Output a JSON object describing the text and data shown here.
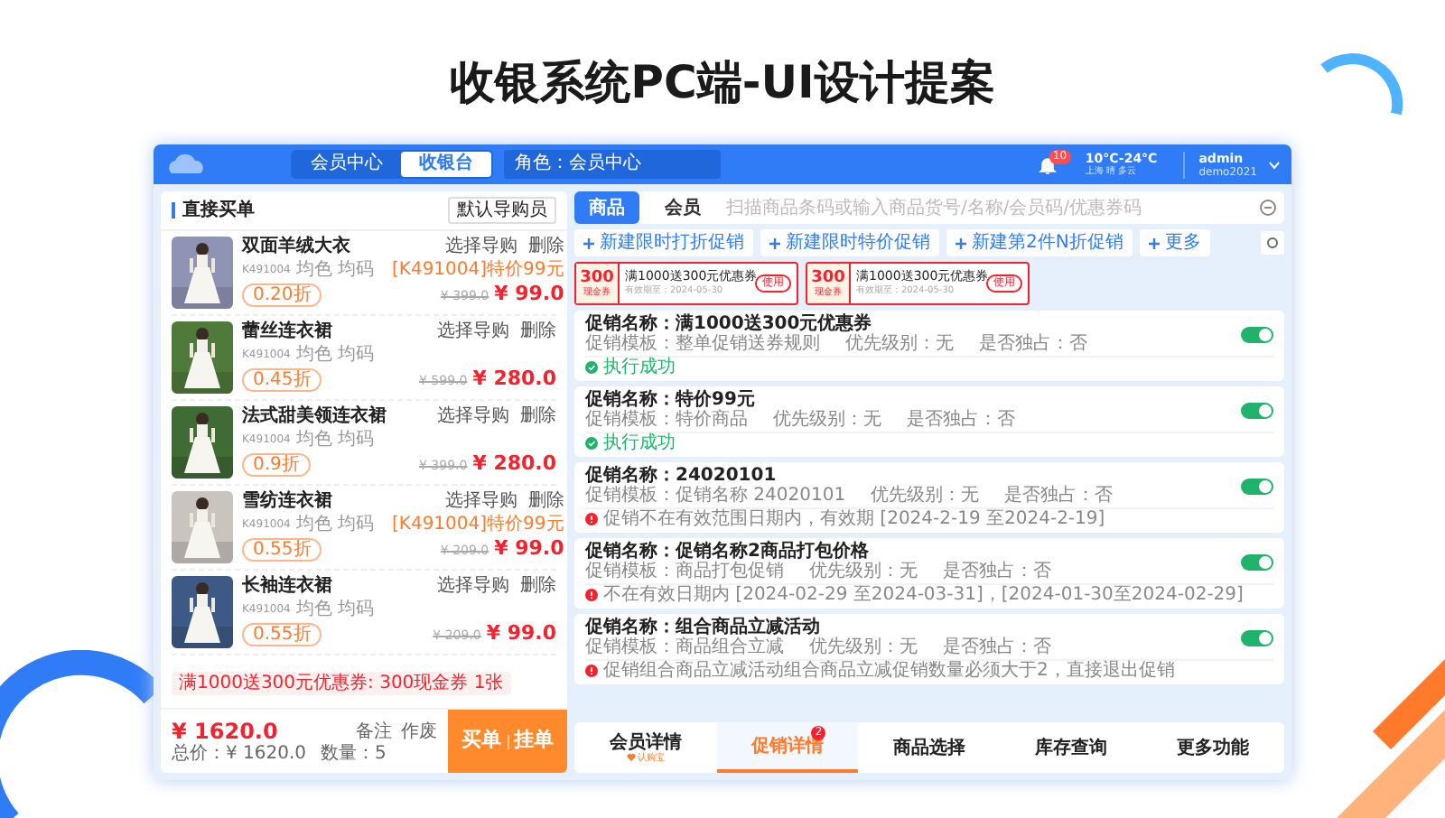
{
  "slide_title": "收银系统PC端-UI设计提案",
  "app": {
    "header": {
      "nav_tabs": [
        {
          "label": "会员中心",
          "selected": false
        },
        {
          "label": "收银台",
          "selected": true
        }
      ],
      "role_select": "角色：会员中心",
      "notification_count": "10",
      "weather": "10°C-24°C",
      "weather_place": "上海 晴 多云",
      "user": "admin",
      "user_id": "demo2021"
    },
    "cart": {
      "title": "直接买单",
      "guide_button": "默认导购员",
      "items": [
        {
          "name": "双面羊绒大衣",
          "code": "K491004",
          "color_name": "均色",
          "size": "均码",
          "discount": "0.20折",
          "guide": "选择导购",
          "delete": "删除",
          "note": "[K491004]特价99元",
          "original_price": "¥ 399.0",
          "price": "¥ 99.0"
        },
        {
          "name": "蕾丝连衣裙",
          "code": "K491004",
          "color_name": "均色",
          "size": "均码",
          "discount": "0.45折",
          "guide": "选择导购",
          "delete": "删除",
          "original_price": "¥ 599.0",
          "price": "¥ 280.0"
        },
        {
          "name": "法式甜美领连衣裙",
          "code": "K491004",
          "color_name": "均色",
          "size": "均码",
          "discount": "0.9折",
          "guide": "选择导购",
          "delete": "删除",
          "original_price": "¥ 399.0",
          "price": "¥ 280.0"
        },
        {
          "name": "雪纺连衣裙",
          "code": "K491004",
          "color_name": "均色",
          "size": "均码",
          "discount": "0.55折",
          "guide": "选择导购",
          "delete": "删除",
          "note": "[K491004]特价99元",
          "original_price": "¥ 209.0",
          "price": "¥ 99.0"
        },
        {
          "name": "长袖连衣裙",
          "code": "K491004",
          "color_name": "均色",
          "size": "均码",
          "discount": "0.55折",
          "guide": "选择导购",
          "delete": "删除",
          "original_price": "¥ 209.0",
          "price": "¥ 99.0"
        }
      ],
      "coupon_note": "满1000送300元优惠券: 300现金券 1张",
      "total": "¥ 1620.0",
      "total_label": "总价：¥ 1620.0",
      "count_label": "数量：5",
      "remark_button": "备注",
      "void_button": "作废",
      "checkout_button": "买单",
      "hold_button": "挂单"
    },
    "panel": {
      "tabs": [
        {
          "label": "商品",
          "selected": true
        },
        {
          "label": "会员",
          "selected": false
        }
      ],
      "search": {
        "placeholder": "扫描商品条码或输入商品货号/名称/会员码/优惠券码"
      },
      "actions": [
        "新建限时打折促销",
        "新建限时特价促销",
        "新建第2件N折促销",
        "更多"
      ],
      "coupons": [
        {
          "amount": "300",
          "unit": "现金券",
          "title": "满1000送300元优惠券",
          "expiry": "有效期至：2024-05-30",
          "action": "使用"
        },
        {
          "amount": "300",
          "unit": "现金券",
          "title": "满1000送300元优惠券",
          "expiry": "有效期至：2024-05-30",
          "action": "使用"
        }
      ],
      "promotions": [
        {
          "name": "促销名称：满1000送300元优惠券",
          "template": "促销模板：整单促销送券规则",
          "priority": "优先级别：无",
          "exclusive": "是否独占：否",
          "on": true,
          "kind": "success",
          "message": "执行成功"
        },
        {
          "name": "促销名称：特价99元",
          "template": "促销模板：特价商品",
          "priority": "优先级别：无",
          "exclusive": "是否独占：否",
          "on": true,
          "kind": "success",
          "message": "执行成功"
        },
        {
          "name": "促销名称：24020101",
          "template": "促销模板：促销名称 24020101",
          "priority": "优先级别：无",
          "exclusive": "是否独占：否",
          "on": true,
          "kind": "error",
          "message": "促销不在有效范围日期内，有效期 [2024-2-19 至2024-2-19]"
        },
        {
          "name": "促销名称：促销名称2商品打包价格",
          "template": "促销模板：商品打包促销",
          "priority": "优先级别：无",
          "exclusive": "是否独占：否",
          "on": true,
          "kind": "error",
          "message": "不在有效日期内 [2024-02-29 至2024-03-31]，[2024-01-30至2024-02-29]"
        },
        {
          "name": "促销名称：组合商品立减活动",
          "template": "促销模板：商品组合立减",
          "priority": "优先级别：无",
          "exclusive": "是否独占：否",
          "on": true,
          "kind": "error",
          "message": "促销组合商品立减活动组合商品立减促销数量必须大于2，直接退出促销"
        }
      ],
      "bottom_tabs": [
        {
          "label": "会员详情",
          "sub": "认购宝",
          "selected": false
        },
        {
          "label": "促销详情",
          "badge": "2",
          "selected": true
        },
        {
          "label": "商品选择",
          "selected": false
        },
        {
          "label": "库存查询",
          "selected": false
        },
        {
          "label": "更多功能",
          "selected": false
        }
      ]
    }
  }
}
